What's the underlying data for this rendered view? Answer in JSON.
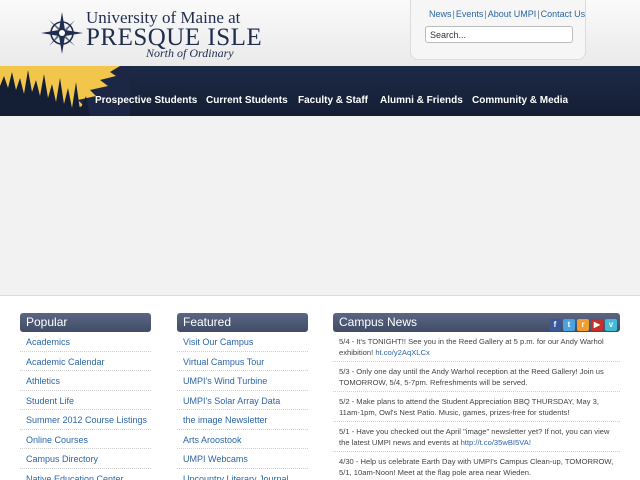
{
  "branding": {
    "line1": "University of Maine at",
    "line2": "PRESQUE ISLE",
    "tagline": "North of Ordinary"
  },
  "utility": {
    "links": [
      "News",
      "Events",
      "About UMPI",
      "Contact Us"
    ],
    "search_placeholder": "Search..."
  },
  "nav": {
    "items": [
      "Prospective Students",
      "Current Students",
      "Faculty & Staff",
      "Alumni & Friends",
      "Community & Media"
    ]
  },
  "popular": {
    "title": "Popular",
    "items": [
      "Academics",
      "Academic Calendar",
      "Athletics",
      "Student Life",
      "Summer 2012 Course Listings",
      "Online Courses",
      "Campus Directory",
      "Native Education Center"
    ]
  },
  "featured": {
    "title": "Featured",
    "items": [
      "Visit Our Campus",
      "Virtual Campus Tour",
      "UMPI's Wind Turbine",
      "UMPI's Solar Array Data",
      "the image Newsletter",
      "Arts Aroostook",
      "UMPI Webcams",
      "Upcountry Literary Journal"
    ]
  },
  "news": {
    "title": "Campus News",
    "social_icons": [
      "facebook-icon",
      "twitter-icon",
      "rss-icon",
      "youtube-icon",
      "vimeo-icon"
    ],
    "social_colors": [
      "#3b5998",
      "#4aa3df",
      "#f39c2c",
      "#c4302b",
      "#44bbd6"
    ],
    "items": [
      {
        "text": "5/4 - It's TONIGHT!! See you in the Reed Gallery at 5 p.m. for our Andy Warhol exhibition! ",
        "link": "ht.co/y2AqXLCx"
      },
      {
        "text": "5/3 - Only one day until the Andy Warhol reception at the Reed Gallery! Join us TOMORROW, 5/4, 5-7pm. Refreshments will be served.",
        "link": ""
      },
      {
        "text": "5/2 - Make plans to attend the Student Appreciation BBQ THURSDAY, May 3, 11am-1pm, Owl's Nest Patio. Music, games, prizes-free for students!",
        "link": ""
      },
      {
        "text": "5/1 - Have you checked out the April \"image\" newsletter yet? If not, you can view the latest UMPI news and events at ",
        "link": "http://t.co/35wBI5VA!"
      },
      {
        "text": "4/30 - Help us celebrate Earth Day with UMPI's Campus Clean-up, TOMORROW, 5/1, 10am-Noon! Meet at the flag pole area near Wieden.",
        "link": ""
      }
    ]
  }
}
